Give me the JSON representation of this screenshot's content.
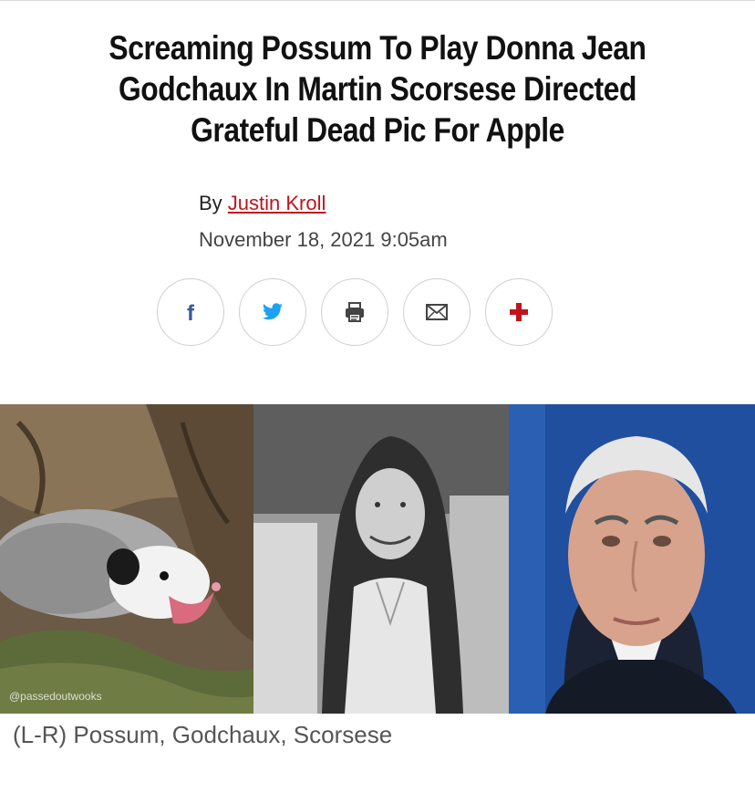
{
  "headline": {
    "line1": "Screaming Possum To Play Donna Jean",
    "line2": "Godchaux In Martin Scorsese Directed",
    "line3": "Grateful Dead Pic For Apple"
  },
  "byline": {
    "prefix": "By ",
    "author": "Justin Kroll"
  },
  "date": "November 18, 2021 9:05am",
  "share_buttons": [
    {
      "name": "facebook",
      "icon": "facebook-icon",
      "color": "#3b5998"
    },
    {
      "name": "twitter",
      "icon": "twitter-icon",
      "color": "#1da1f2"
    },
    {
      "name": "print",
      "icon": "print-icon",
      "color": "#444444"
    },
    {
      "name": "email",
      "icon": "email-icon",
      "color": "#444444"
    },
    {
      "name": "more",
      "icon": "plus-icon",
      "color": "#c0131c"
    }
  ],
  "photos": {
    "watermark": "@passedoutwooks"
  },
  "caption": "(L-R) Possum, Godchaux, Scorsese"
}
